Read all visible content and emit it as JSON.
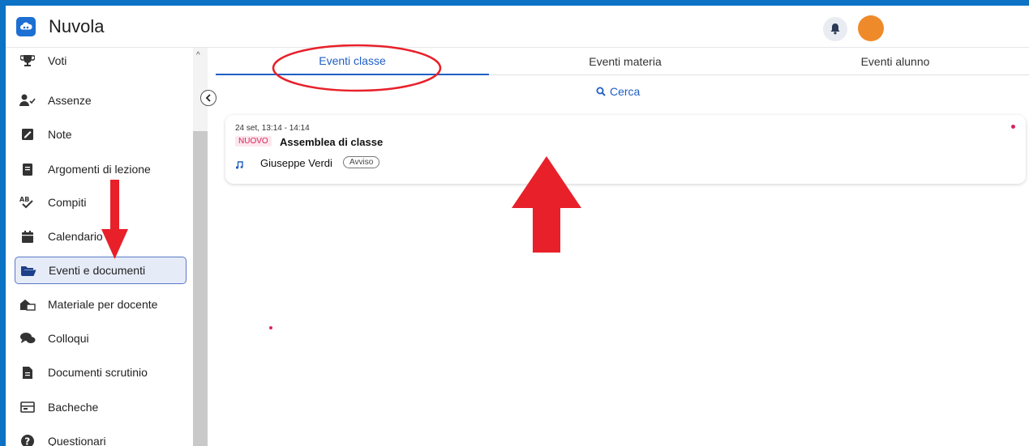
{
  "header": {
    "app_title": "Nuvola",
    "bell_icon": "bell-icon",
    "avatar_color": "#ef8a2a",
    "brand_color": "#1c6fd3"
  },
  "sidebar": {
    "items": [
      {
        "label": "Voti",
        "icon": "trophy-icon"
      },
      {
        "label": "Assenze",
        "icon": "user-check-icon"
      },
      {
        "label": "Note",
        "icon": "note-icon"
      },
      {
        "label": "Argomenti di lezione",
        "icon": "book-icon"
      },
      {
        "label": "Compiti",
        "icon": "spellcheck-icon"
      },
      {
        "label": "Calendario",
        "icon": "calendar-icon"
      },
      {
        "label": "Eventi e documenti",
        "icon": "folder-open-icon",
        "active": true
      },
      {
        "label": "Materiale per docente",
        "icon": "teacher-material-icon"
      },
      {
        "label": "Colloqui",
        "icon": "chat-icon"
      },
      {
        "label": "Documenti scrutinio",
        "icon": "document-icon"
      },
      {
        "label": "Bacheche",
        "icon": "board-icon"
      },
      {
        "label": "Questionari",
        "icon": "question-icon"
      }
    ]
  },
  "tabs": [
    {
      "label": "Eventi classe",
      "active": true
    },
    {
      "label": "Eventi materia",
      "active": false
    },
    {
      "label": "Eventi alunno",
      "active": false
    }
  ],
  "search": {
    "label": "Cerca",
    "icon": "search-icon"
  },
  "events": [
    {
      "time": "24 set, 13:14 - 14:14",
      "badge": "NUOVO",
      "title": "Assemblea di classe",
      "author": "Giuseppe Verdi",
      "author_icon": "music-note-icon",
      "tag": "Avviso",
      "unread": true
    }
  ],
  "colors": {
    "accent": "#1f5fc4",
    "badge": "#d6245a",
    "annotation": "#e8202a",
    "frame": "#0b72c4"
  }
}
